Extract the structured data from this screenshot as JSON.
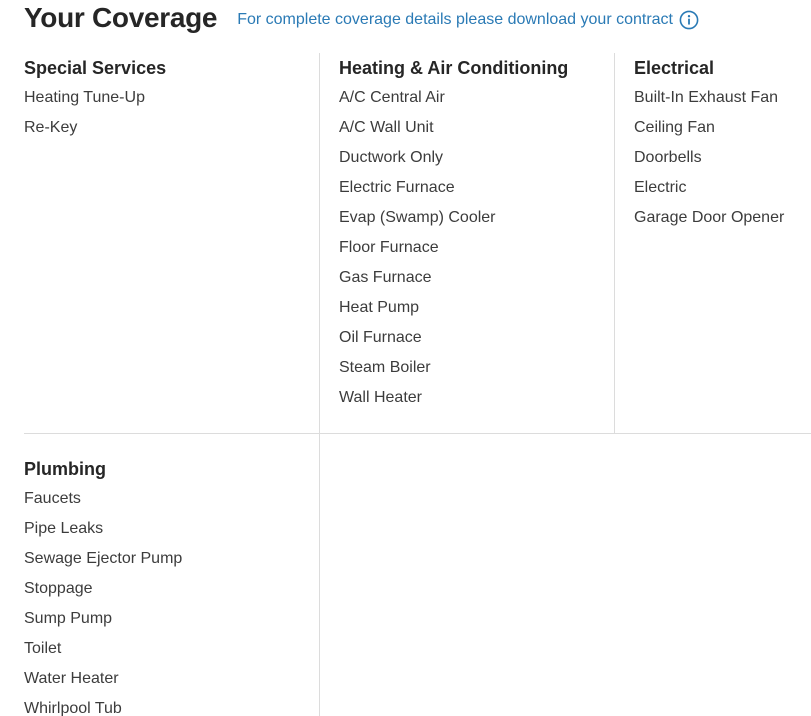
{
  "header": {
    "title": "Your Coverage",
    "contract_link": "For complete coverage details please download your contract",
    "info_icon": "info-icon",
    "link_color": "#2a7ab5"
  },
  "categories": {
    "special_services": {
      "title": "Special Services",
      "items": [
        "Heating Tune-Up",
        "Re-Key"
      ]
    },
    "heating_ac": {
      "title": "Heating & Air Conditioning",
      "items": [
        "A/C Central Air",
        "A/C Wall Unit",
        "Ductwork Only",
        "Electric Furnace",
        "Evap (Swamp) Cooler",
        "Floor Furnace",
        "Gas Furnace",
        "Heat Pump",
        "Oil Furnace",
        "Steam Boiler",
        "Wall Heater"
      ]
    },
    "electrical": {
      "title": "Electrical",
      "items": [
        "Built-In Exhaust Fan",
        "Ceiling Fan",
        "Doorbells",
        "Electric",
        "Garage Door Opener"
      ]
    },
    "plumbing": {
      "title": "Plumbing",
      "items": [
        "Faucets",
        "Pipe Leaks",
        "Sewage Ejector Pump",
        "Stoppage",
        "Sump Pump",
        "Toilet",
        "Water Heater",
        "Whirlpool Tub"
      ]
    }
  }
}
